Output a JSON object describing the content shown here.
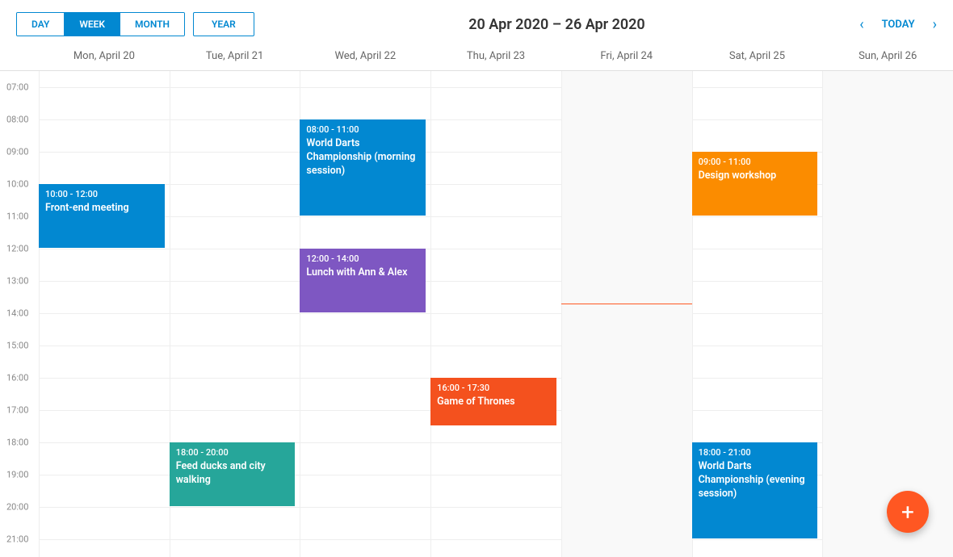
{
  "header": {
    "views": {
      "day": "DAY",
      "week": "WEEK",
      "month": "MONTH",
      "year": "YEAR",
      "active": "week"
    },
    "date_range": "20 Apr 2020 – 26 Apr 2020",
    "today_label": "TODAY"
  },
  "days": [
    {
      "label": "Mon, April 20"
    },
    {
      "label": "Tue, April 21"
    },
    {
      "label": "Wed, April 22"
    },
    {
      "label": "Thu, April 23"
    },
    {
      "label": "Fri, April 24",
      "shaded": true
    },
    {
      "label": "Sat, April 25"
    },
    {
      "label": "Sun, April 26",
      "shaded": true
    }
  ],
  "time_labels": [
    "07:00",
    "08:00",
    "09:00",
    "10:00",
    "11:00",
    "12:00",
    "13:00",
    "14:00",
    "15:00",
    "16:00",
    "17:00",
    "18:00",
    "19:00",
    "20:00",
    "21:00"
  ],
  "hour_height": 40,
  "start_hour": 6.5,
  "now_marker": {
    "day": 4,
    "hour": 13.7
  },
  "events": [
    {
      "day": 0,
      "start": 10.0,
      "end": 12.0,
      "time": "10:00 - 12:00",
      "title": "Front-end meeting",
      "color": "#0288d1"
    },
    {
      "day": 1,
      "start": 18.0,
      "end": 20.0,
      "time": "18:00 - 20:00",
      "title": "Feed ducks and city walking",
      "color": "#26a69a"
    },
    {
      "day": 2,
      "start": 8.0,
      "end": 11.0,
      "time": "08:00 - 11:00",
      "title": "World Darts Championship (morning session)",
      "color": "#0288d1"
    },
    {
      "day": 2,
      "start": 12.0,
      "end": 14.0,
      "time": "12:00 - 14:00",
      "title": "Lunch with Ann & Alex",
      "color": "#7e57c2"
    },
    {
      "day": 3,
      "start": 16.0,
      "end": 17.5,
      "time": "16:00 - 17:30",
      "title": "Game of Thrones",
      "color": "#f4511e"
    },
    {
      "day": 5,
      "start": 9.0,
      "end": 11.0,
      "time": "09:00 - 11:00",
      "title": "Design workshop",
      "color": "#fb8c00"
    },
    {
      "day": 5,
      "start": 18.0,
      "end": 21.0,
      "time": "18:00 - 21:00",
      "title": "World Darts Championship (evening session)",
      "color": "#0288d1"
    }
  ],
  "fab": {
    "icon": "+"
  }
}
